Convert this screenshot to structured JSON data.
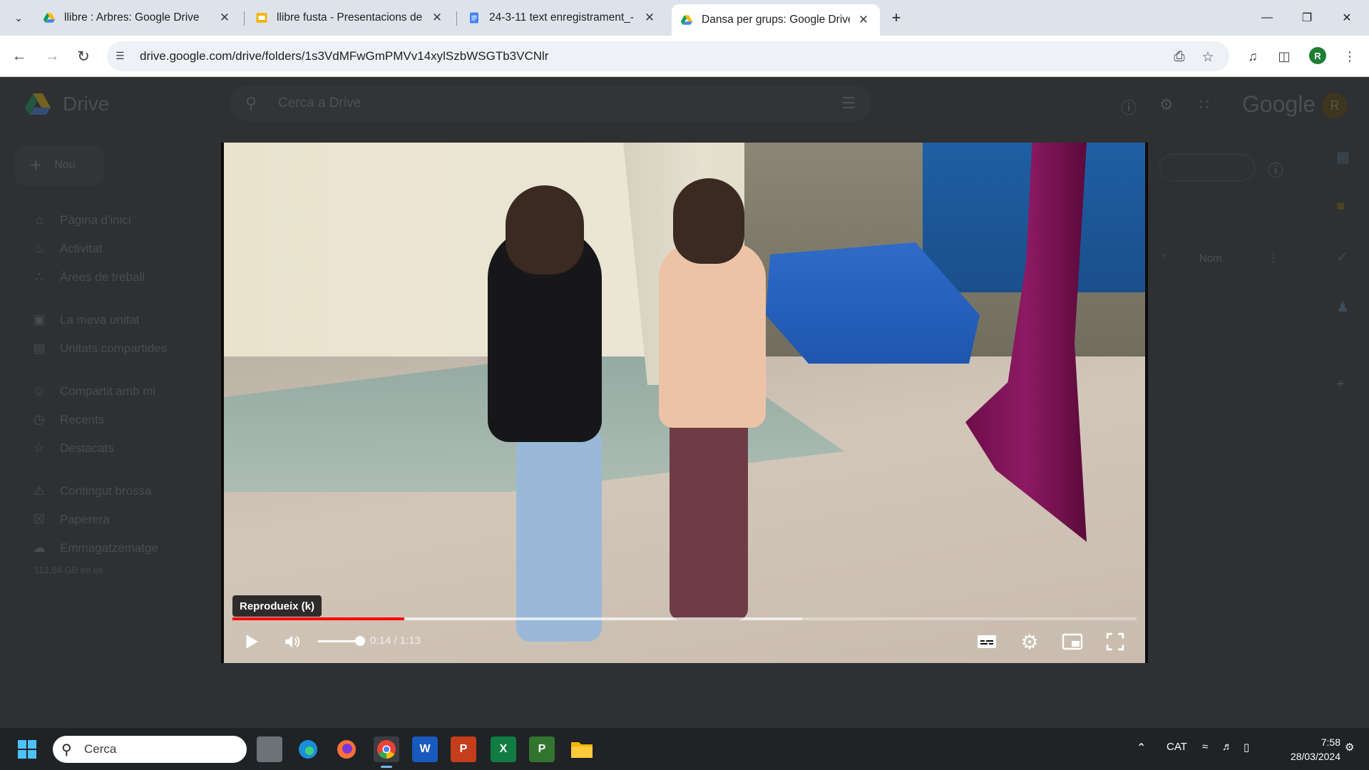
{
  "browser": {
    "tabs": [
      {
        "title": "llibre : Arbres: Google Drive",
        "favicon": "google-drive-icon",
        "active": false
      },
      {
        "title": "llibre fusta - Presentacions de Google",
        "favicon": "google-slides-icon",
        "active": false
      },
      {
        "title": "24-3-11 text enregistrament_-",
        "favicon": "google-docs-icon",
        "active": false
      },
      {
        "title": "Dansa per grups: Google Drive",
        "favicon": "google-drive-icon",
        "active": true
      }
    ],
    "url": "drive.google.com/drive/folders/1s3VdMFwGmPMVv14xylSzbWSGTb3VCNlr",
    "profile_initial": "R"
  },
  "drive": {
    "app_name": "Drive",
    "search_placeholder": "Cerca a Drive",
    "new_button": "Nou",
    "brand": "Google",
    "avatar_initial": "R",
    "sidebar": [
      {
        "label": "Pàgina d'inici",
        "icon": "home-icon"
      },
      {
        "label": "Activitat",
        "icon": "bell-icon"
      },
      {
        "label": "Àrees de treball",
        "icon": "workspaces-icon"
      },
      {
        "label": "La meva unitat",
        "icon": "my-drive-icon"
      },
      {
        "label": "Unitats compartides",
        "icon": "shared-drives-icon"
      },
      {
        "label": "Compartit amb mi",
        "icon": "people-icon"
      },
      {
        "label": "Recents",
        "icon": "clock-icon"
      },
      {
        "label": "Destacats",
        "icon": "star-icon"
      },
      {
        "label": "Contingut brossa",
        "icon": "spam-icon"
      },
      {
        "label": "Paperera",
        "icon": "trash-icon"
      },
      {
        "label": "Emmagatzematge",
        "icon": "cloud-icon"
      }
    ],
    "storage_text": "112,84 GB en ús",
    "sort_label": "Nom"
  },
  "player": {
    "tooltip": "Reprodueix (k)",
    "current_time": "0:14",
    "duration": "1:13",
    "time_separator": " / ",
    "played_fraction": 0.19,
    "buffered_fraction": 0.63,
    "volume_fraction": 0.8
  },
  "taskbar": {
    "search_placeholder": "Cerca",
    "language": "CAT",
    "time": "7:58",
    "date": "28/03/2024",
    "apps": [
      "task-view-icon",
      "edge-icon",
      "firefox-icon",
      "chrome-icon",
      "word-icon",
      "powerpoint-icon",
      "excel-icon",
      "project-icon",
      "file-explorer-icon"
    ]
  }
}
